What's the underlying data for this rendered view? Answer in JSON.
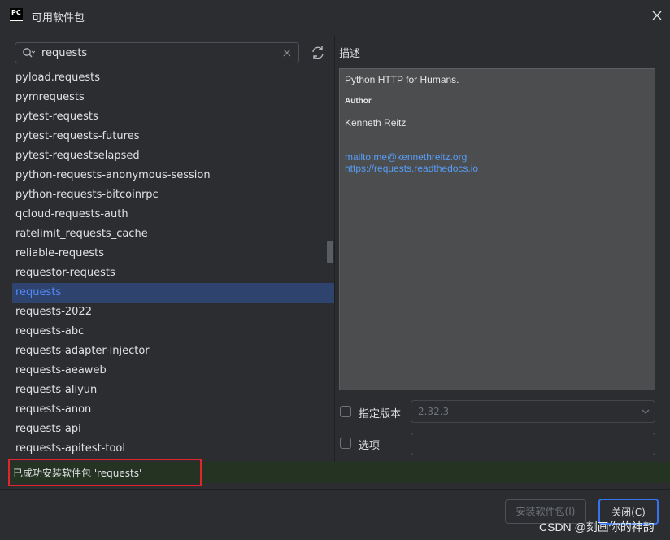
{
  "window": {
    "app_icon_text": "PC",
    "title": "可用软件包"
  },
  "search": {
    "value": "requests"
  },
  "packages": [
    "pyload.requests",
    "pymrequests",
    "pytest-requests",
    "pytest-requests-futures",
    "pytest-requestselapsed",
    "python-requests-anonymous-session",
    "python-requests-bitcoinrpc",
    "qcloud-requests-auth",
    "ratelimit_requests_cache",
    "reliable-requests",
    "requestor-requests",
    "requests",
    "requests-2022",
    "requests-abc",
    "requests-adapter-injector",
    "requests-aeaweb",
    "requests-aliyun",
    "requests-anon",
    "requests-api",
    "requests-apitest-tool"
  ],
  "selected_package": "requests",
  "description": {
    "label": "描述",
    "summary": "Python HTTP for Humans.",
    "author_heading": "Author",
    "author": "Kenneth Reitz",
    "email_link": "mailto:me@kennethreitz.org",
    "docs_link": "https://requests.readthedocs.io"
  },
  "options": {
    "specify_version_label": "指定版本",
    "version_value": "2.32.3",
    "options_label": "选项",
    "options_value": ""
  },
  "status": {
    "message": "已成功安装软件包 'requests'"
  },
  "buttons": {
    "install": "安装软件包(I)",
    "close": "关闭(C)"
  },
  "watermark": "CSDN @刻画你的神韵",
  "colors": {
    "background": "#2b2d30",
    "selection_bg": "#2e436e",
    "selection_text": "#548af7",
    "link": "#589df6",
    "status_bg": "#253322",
    "highlight_border": "#e0262a",
    "primary_border": "#3574f0"
  }
}
